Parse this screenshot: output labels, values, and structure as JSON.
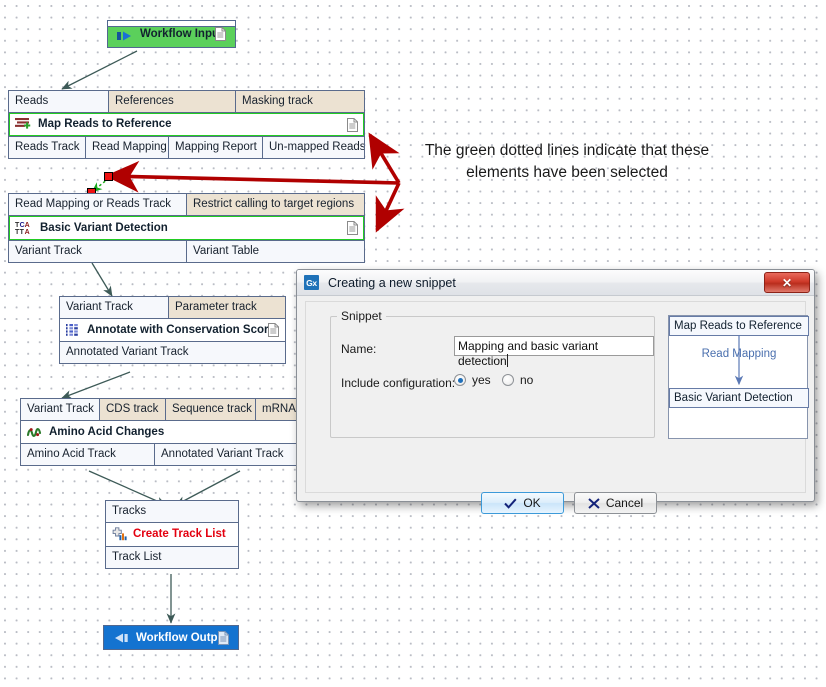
{
  "canvas": {
    "annotation": {
      "line1": "The green dotted lines indicate that these",
      "line2": "elements have been selected",
      "color": "#b00000"
    },
    "workflow_input": {
      "label": "Workflow Input",
      "icon": "arrow-right-icon",
      "color": "#5bd05b"
    },
    "workflow_output": {
      "label": "Workflow Output",
      "icon": "arrow-left-icon",
      "color": "#1473d0"
    },
    "blocks": [
      {
        "name": "Map Reads to Reference",
        "selected": true,
        "inputs": [
          {
            "label": "Reads",
            "connected": true
          },
          {
            "label": "References",
            "connected": false
          },
          {
            "label": "Masking track",
            "connected": false
          }
        ],
        "outputs": [
          {
            "label": "Reads Track"
          },
          {
            "label": "Read Mapping"
          },
          {
            "label": "Mapping Report"
          },
          {
            "label": "Un-mapped Reads"
          }
        ]
      },
      {
        "name": "Basic Variant Detection",
        "selected": true,
        "inputs": [
          {
            "label": "Read Mapping or Reads Track",
            "connected": true
          },
          {
            "label": "Restrict calling to target regions",
            "connected": false
          }
        ],
        "outputs": [
          {
            "label": "Variant Track"
          },
          {
            "label": "Variant Table"
          }
        ]
      },
      {
        "name": "Annotate with Conservation Score",
        "selected": false,
        "inputs": [
          {
            "label": "Variant Track",
            "connected": true
          },
          {
            "label": "Parameter track",
            "connected": false
          }
        ],
        "outputs": [
          {
            "label": "Annotated Variant Track"
          }
        ]
      },
      {
        "name": "Amino Acid Changes",
        "selected": false,
        "inputs": [
          {
            "label": "Variant Track",
            "connected": true
          },
          {
            "label": "CDS track",
            "connected": false
          },
          {
            "label": "Sequence track",
            "connected": false
          },
          {
            "label": "mRNA track",
            "connected": false
          }
        ],
        "outputs": [
          {
            "label": "Amino Acid Track"
          },
          {
            "label": "Annotated Variant Track"
          }
        ]
      },
      {
        "name": "Create Track List",
        "error": true,
        "selected": false,
        "inputs": [
          {
            "label": "Tracks",
            "connected": true
          }
        ],
        "outputs": [
          {
            "label": "Track List"
          }
        ]
      }
    ]
  },
  "dialog": {
    "title": "Creating a new snippet",
    "app_icon_text": "Gx",
    "close_label": "✕",
    "group_label": "Snippet",
    "name_label": "Name:",
    "name_value": "Mapping and basic variant detection",
    "name_placeholder": "",
    "config_label": "Include configuration:",
    "radio_yes": "yes",
    "radio_no": "no",
    "radio_selected": "yes",
    "ok_label": "OK",
    "cancel_label": "Cancel",
    "preview": {
      "top_node": "Map Reads to Reference",
      "connection_label": "Read Mapping",
      "bottom_node": "Basic Variant Detection"
    }
  }
}
